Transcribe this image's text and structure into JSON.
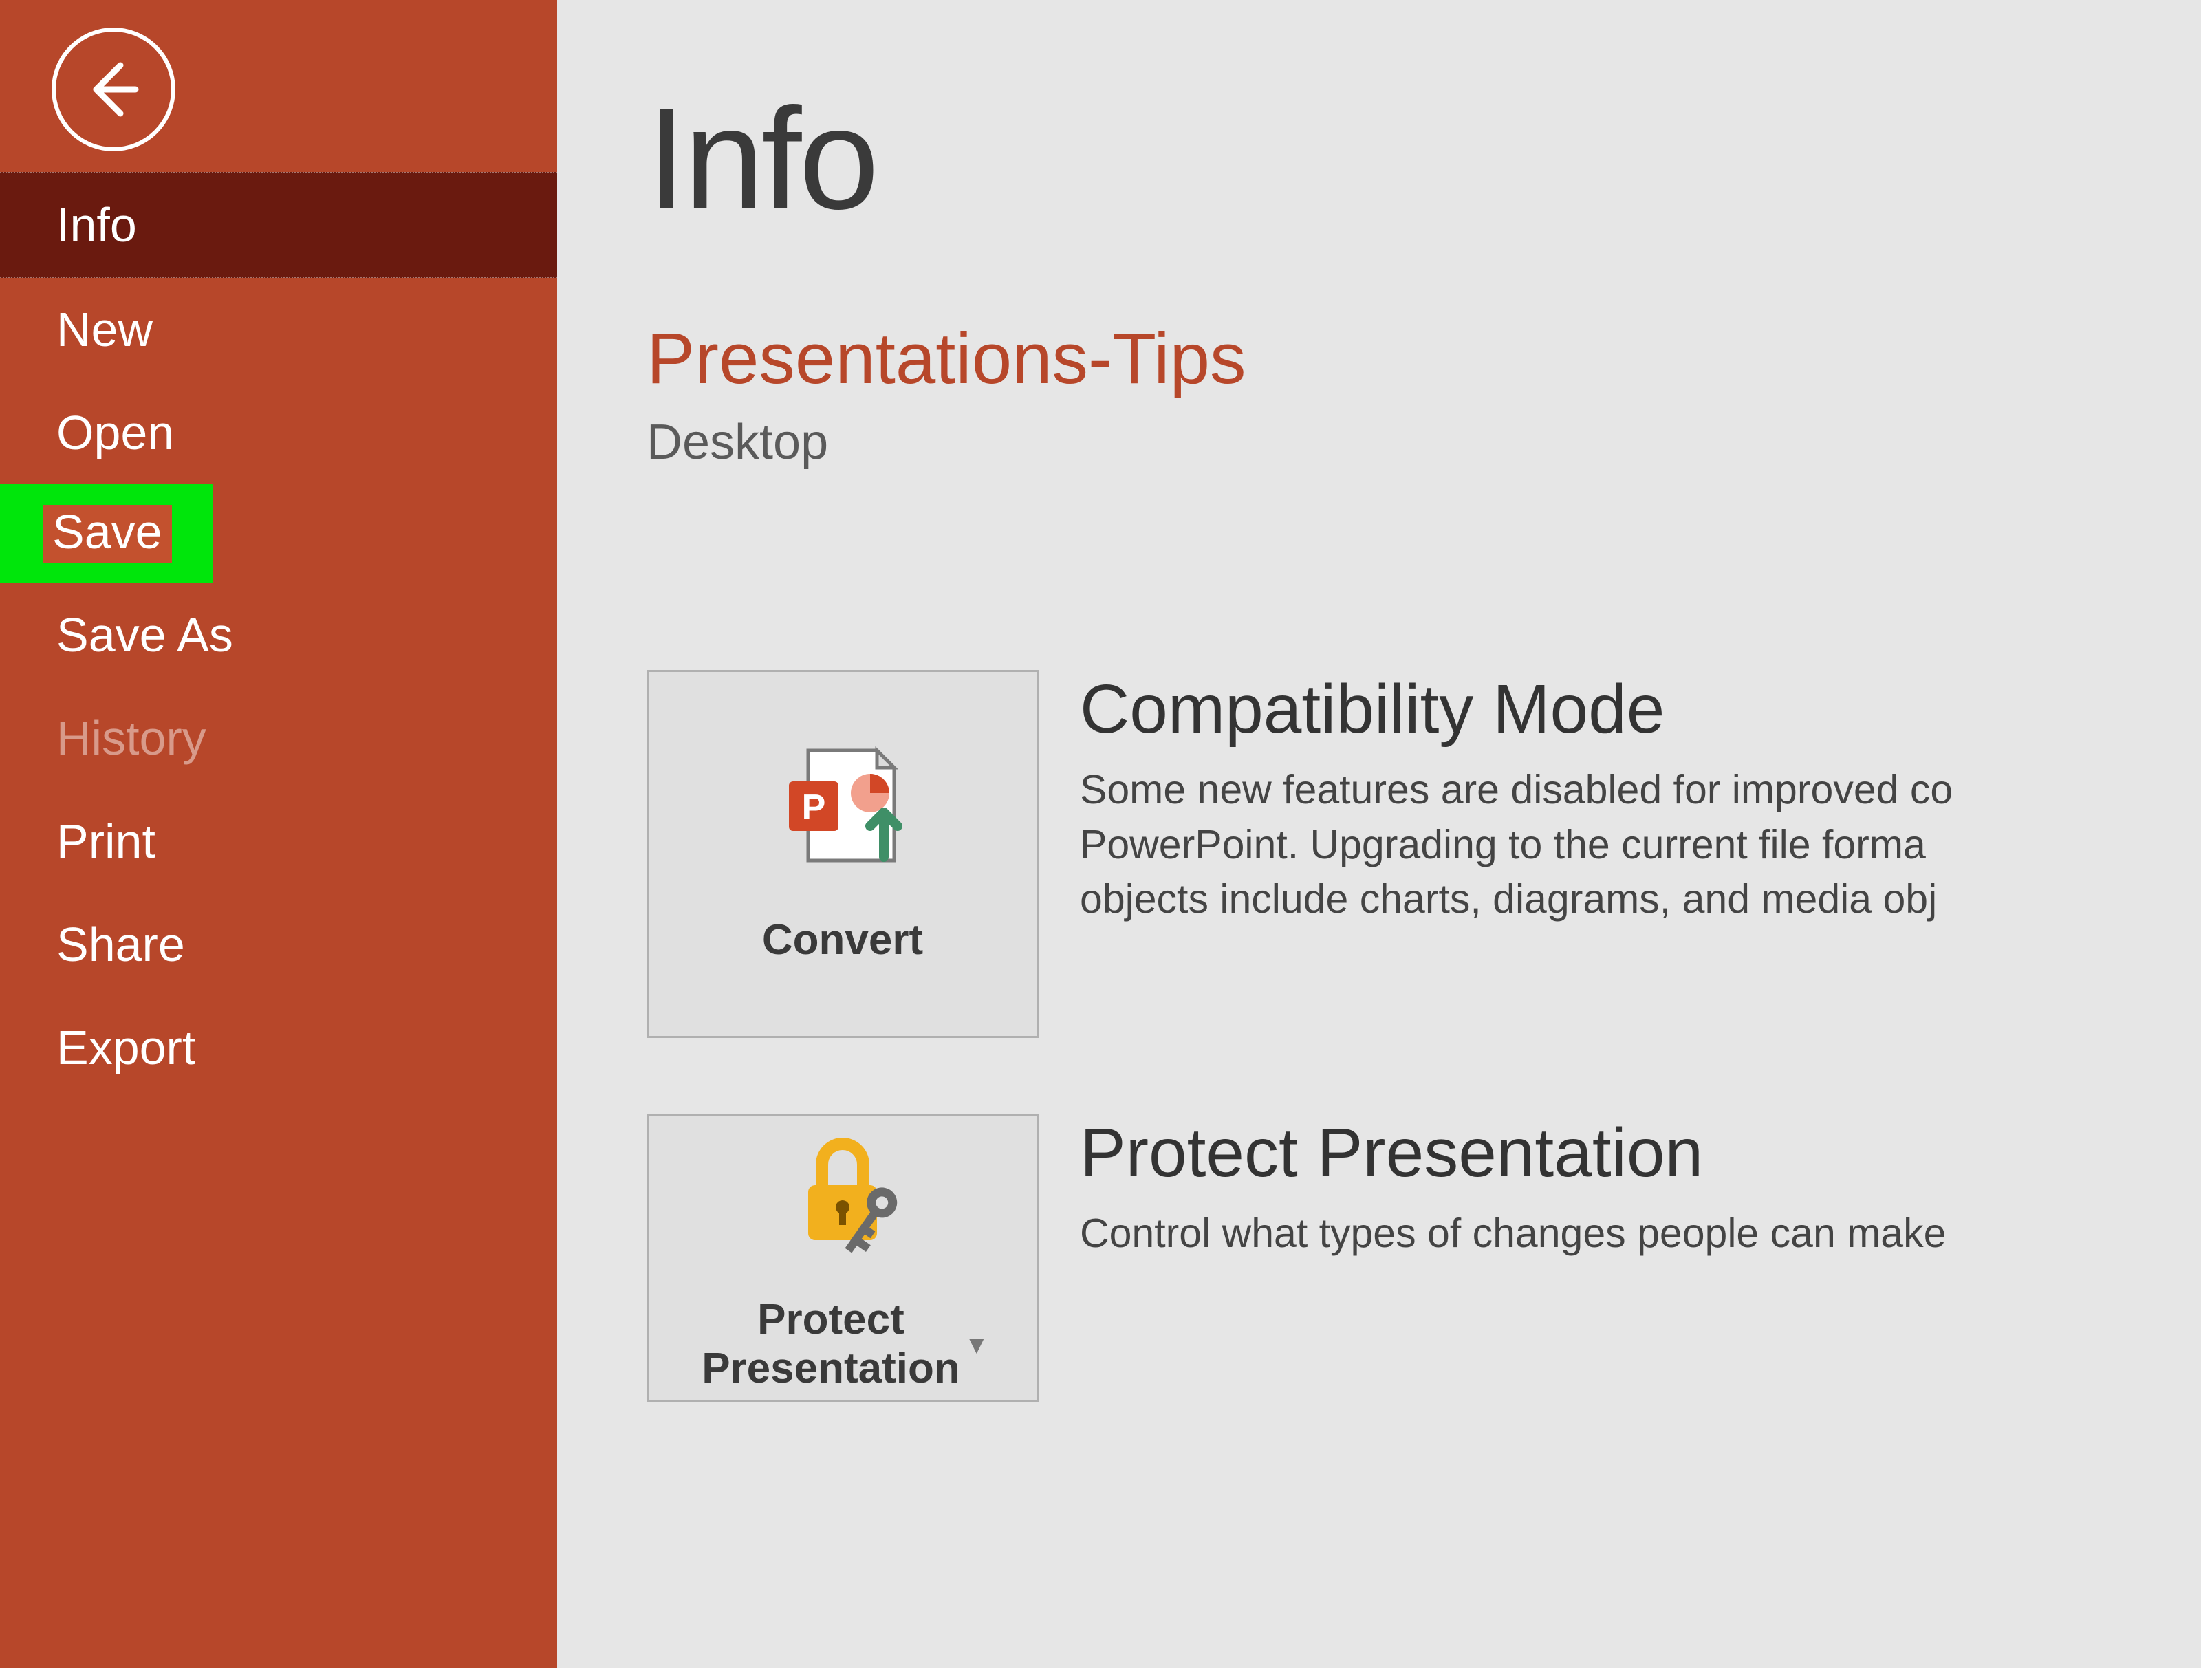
{
  "sidebar": {
    "items": [
      {
        "label": "Info",
        "selected": true,
        "disabled": false
      },
      {
        "label": "New",
        "selected": false,
        "disabled": false
      },
      {
        "label": "Open",
        "selected": false,
        "disabled": false
      },
      {
        "label": "Save",
        "selected": false,
        "disabled": false,
        "highlighted": true
      },
      {
        "label": "Save As",
        "selected": false,
        "disabled": false
      },
      {
        "label": "History",
        "selected": false,
        "disabled": true
      },
      {
        "label": "Print",
        "selected": false,
        "disabled": false
      },
      {
        "label": "Share",
        "selected": false,
        "disabled": false
      },
      {
        "label": "Export",
        "selected": false,
        "disabled": false
      }
    ]
  },
  "page": {
    "title": "Info",
    "document_title": "Presentations-Tips",
    "document_location": "Desktop"
  },
  "sections": {
    "compat": {
      "button_label": "Convert",
      "title": "Compatibility Mode",
      "desc": "Some new features are disabled for improved co\nPowerPoint. Upgrading to the current file forma\nobjects include charts, diagrams, and media obj"
    },
    "protect": {
      "button_label": "Protect\nPresentation",
      "title": "Protect Presentation",
      "desc": "Control what types of changes people can make"
    }
  },
  "icons": {
    "back": "back-arrow-icon",
    "convert": "powerpoint-convert-icon",
    "protect": "lock-key-icon",
    "dropdown": "chevron-down-icon"
  }
}
